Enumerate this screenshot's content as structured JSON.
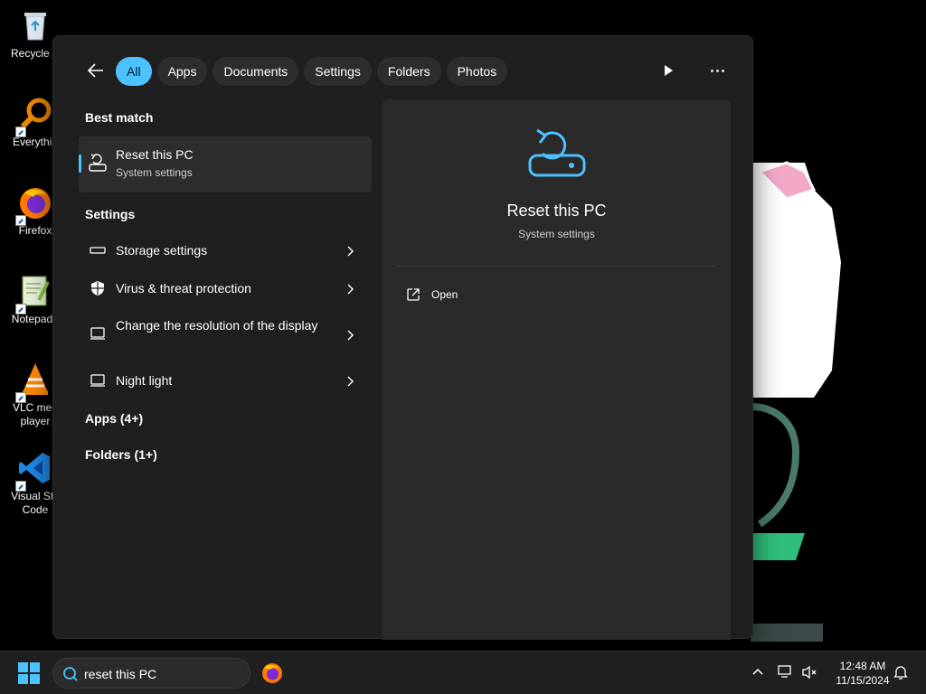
{
  "desktop": {
    "icons": [
      {
        "label": "Recycle B",
        "icon": "recycle-bin-icon"
      },
      {
        "label": "Everythin",
        "icon": "everything-search-icon"
      },
      {
        "label": "Firefox",
        "icon": "firefox-icon"
      },
      {
        "label": "Notepad+",
        "icon": "notepad-plus-plus-icon"
      },
      {
        "label": "VLC med\nplayer",
        "icon": "vlc-icon"
      },
      {
        "label": "Visual Stu\nCode",
        "icon": "vscode-icon"
      }
    ]
  },
  "search": {
    "tabs": [
      {
        "label": "All",
        "active": true
      },
      {
        "label": "Apps"
      },
      {
        "label": "Documents"
      },
      {
        "label": "Settings"
      },
      {
        "label": "Folders"
      },
      {
        "label": "Photos"
      }
    ],
    "best_match_heading": "Best match",
    "best_match": {
      "title": "Reset this PC",
      "subtitle": "System settings"
    },
    "settings_heading": "Settings",
    "settings_items": [
      {
        "label": "Storage settings",
        "icon": "storage-icon"
      },
      {
        "label": "Virus & threat protection",
        "icon": "shield-icon"
      },
      {
        "label": "Change the resolution of the display",
        "icon": "display-icon"
      },
      {
        "label": "Night light",
        "icon": "display-icon"
      }
    ],
    "apps_heading": "Apps (4+)",
    "folders_heading": "Folders (1+)",
    "preview": {
      "title": "Reset this PC",
      "subtitle": "System settings",
      "open_label": "Open"
    }
  },
  "taskbar": {
    "search_value": "reset this PC",
    "time": "12:48 AM",
    "date": "11/15/2024"
  },
  "colors": {
    "accent": "#4cc2ff",
    "panel": "#1f1f1f",
    "taskbar": "#202020"
  }
}
